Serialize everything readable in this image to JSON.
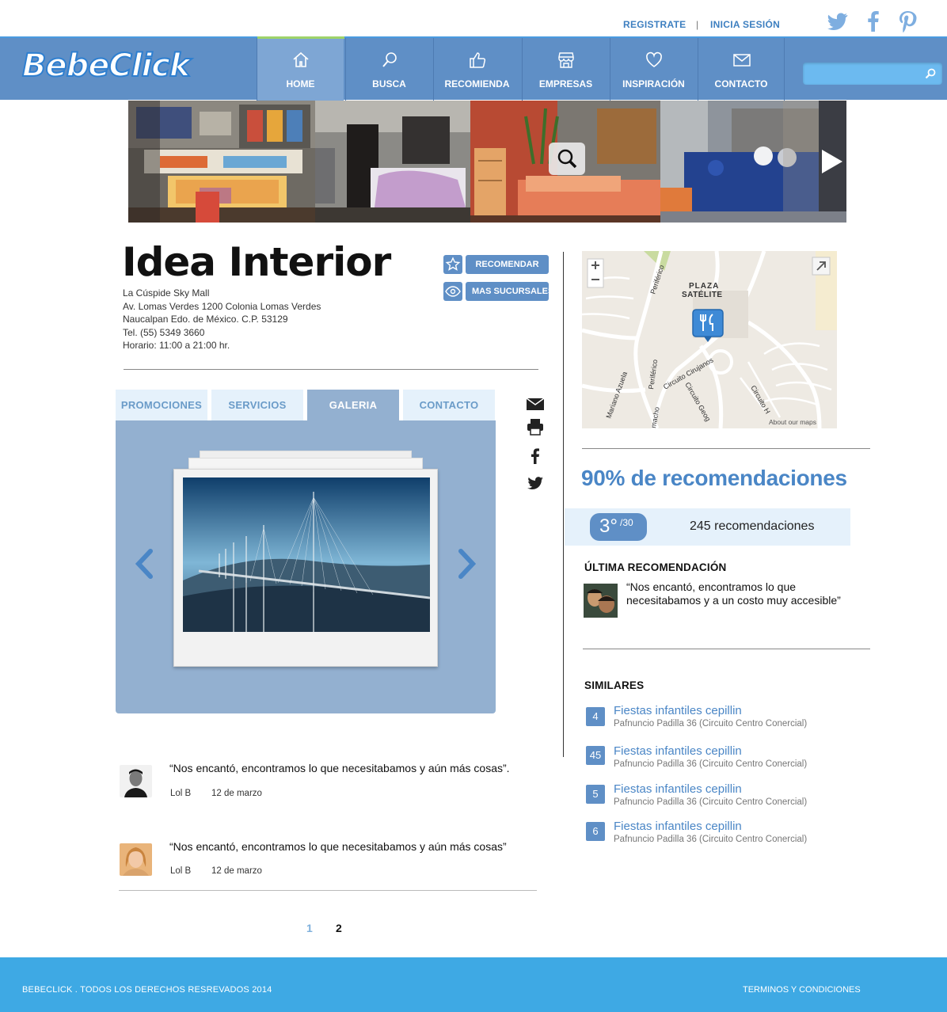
{
  "header": {
    "register_label": "REGISTRATE",
    "separator": "|",
    "login_label": "INICIA SESIÓN",
    "social": [
      "twitter-icon",
      "facebook-icon",
      "pinterest-icon"
    ]
  },
  "nav": {
    "logo": "BebeClick",
    "items": [
      {
        "label": "HOME",
        "icon": "home-icon",
        "active": true
      },
      {
        "label": "BUSCA",
        "icon": "search-icon"
      },
      {
        "label": "RECOMIENDA",
        "icon": "thumbs-up-icon"
      },
      {
        "label": "EMPRESAS",
        "icon": "store-icon"
      },
      {
        "label": "INSPIRACIÓN",
        "icon": "heart-icon"
      },
      {
        "label": "CONTACTO",
        "icon": "mail-icon"
      }
    ],
    "search_placeholder": "",
    "colors": {
      "bar": "#5f8fc6",
      "active": "#7ea6d4",
      "accent": "#3ea9e4"
    }
  },
  "business": {
    "name": "Idea Interior",
    "address_lines": [
      "La Cúspide Sky Mall",
      "Av. Lomas Verdes 1200 Colonia Lomas Verdes",
      "Naucalpan Edo. de México. C.P. 53129",
      "Tel. (55) 5349 3660",
      "Horario: 11:00 a 21:00 hr."
    ],
    "recommend_label": "RECOMENDAR",
    "branches_label": "MAS SUCURSALES"
  },
  "tabs": [
    {
      "label": "PROMOCIONES"
    },
    {
      "label": "SERVICIOS"
    },
    {
      "label": "GALERIA",
      "active": true
    },
    {
      "label": "CONTACTO"
    }
  ],
  "reviews": [
    {
      "text": "“Nos encantó, encontramos lo que necesitabamos y aún más cosas”.",
      "author": "Lol B",
      "date": "12 de marzo"
    },
    {
      "text": "“Nos encantó, encontramos lo que necesitabamos y aún más cosas”",
      "author": "Lol B",
      "date": "12 de marzo"
    }
  ],
  "pagination": {
    "pages": [
      "1",
      "2"
    ],
    "current": "1"
  },
  "map": {
    "labels": [
      "PLAZA",
      "SATÉLITE",
      "Periférico",
      "Circuito Cirujanos",
      "Mariano Azuela",
      "Circuito H",
      "Circuito Geog",
      "macho"
    ],
    "attribution": "About our maps"
  },
  "stats": {
    "percent_label": "90% de recomendaciones",
    "rank": "3°",
    "rank_total": "/30",
    "count_label": "245 recomendaciones"
  },
  "last_recommendation": {
    "heading": "ÚLTIMA RECOMENDACIÓN",
    "text": "“Nos encantó, encontramos lo que necesitabamos y a un costo muy accesible”"
  },
  "similar": {
    "heading": "SIMILARES",
    "items": [
      {
        "num": "4",
        "title": "Fiestas infantiles cepillin",
        "address": "Pafnuncio Padilla 36 (Circuito Centro Conercial)"
      },
      {
        "num": "45",
        "title": "Fiestas infantiles cepillin",
        "address": "Pafnuncio Padilla 36 (Circuito Centro Conercial)"
      },
      {
        "num": "5",
        "title": "Fiestas infantiles cepillin",
        "address": "Pafnuncio Padilla 36 (Circuito Centro Conercial)"
      },
      {
        "num": "6",
        "title": "Fiestas infantiles cepillin",
        "address": "Pafnuncio Padilla 36 (Circuito Centro Conercial)"
      }
    ]
  },
  "footer": {
    "copyright": "BEBECLICK . TODOS LOS DERECHOS RESREVADOS 2014",
    "terms": "TERMINOS Y CONDICIONES"
  }
}
